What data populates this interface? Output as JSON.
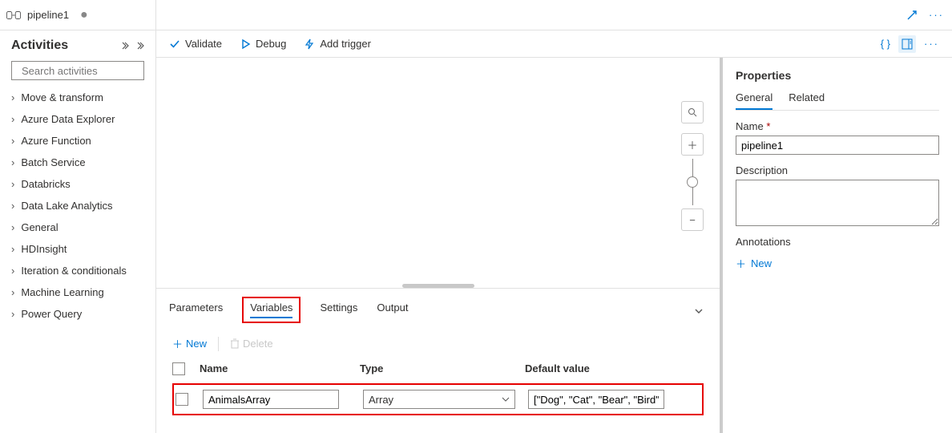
{
  "titlebar": {
    "name": "pipeline1",
    "dirty": "●"
  },
  "activities": {
    "heading": "Activities",
    "search_placeholder": "Search activities",
    "categories": [
      "Move & transform",
      "Azure Data Explorer",
      "Azure Function",
      "Batch Service",
      "Databricks",
      "Data Lake Analytics",
      "General",
      "HDInsight",
      "Iteration & conditionals",
      "Machine Learning",
      "Power Query"
    ]
  },
  "toolbar": {
    "validate": "Validate",
    "debug": "Debug",
    "addTrigger": "Add trigger"
  },
  "bottomTabs": {
    "parameters": "Parameters",
    "variables": "Variables",
    "settings": "Settings",
    "output": "Output"
  },
  "varActions": {
    "new": "New",
    "delete": "Delete"
  },
  "varHeaders": {
    "name": "Name",
    "type": "Type",
    "default": "Default value"
  },
  "variable": {
    "name": "AnimalsArray",
    "type": "Array",
    "default": "[\"Dog\", \"Cat\", \"Bear\", \"Bird\"]"
  },
  "properties": {
    "title": "Properties",
    "tabs": {
      "general": "General",
      "related": "Related"
    },
    "nameLabel": "Name",
    "nameValue": "pipeline1",
    "descLabel": "Description",
    "annotLabel": "Annotations",
    "newLabel": "New"
  }
}
